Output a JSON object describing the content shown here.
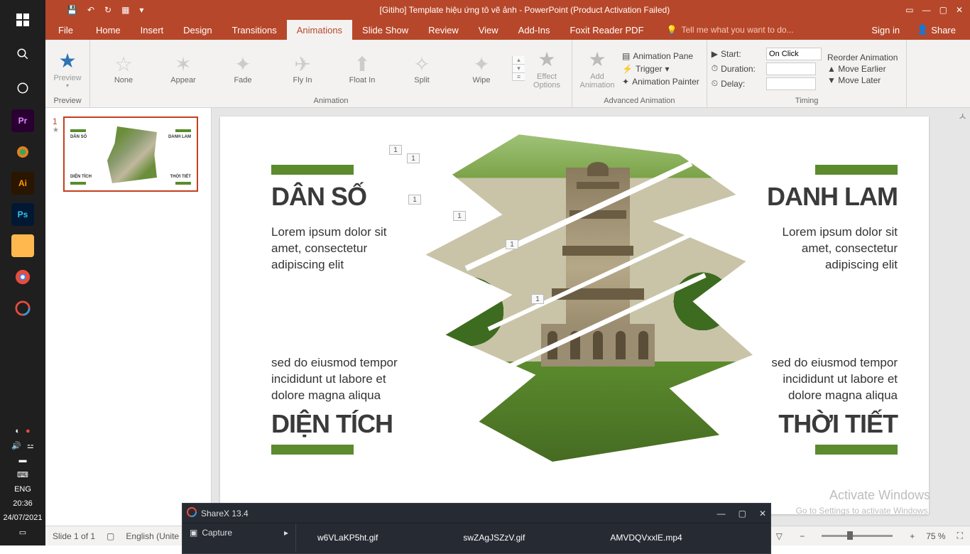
{
  "titlebar": {
    "title": "[Gitiho] Template hiệu ứng tô vẽ ảnh - PowerPoint (Product Activation Failed)"
  },
  "tabs": {
    "file": "File",
    "home": "Home",
    "insert": "Insert",
    "design": "Design",
    "transitions": "Transitions",
    "animations": "Animations",
    "slideshow": "Slide Show",
    "review": "Review",
    "view": "View",
    "addins": "Add-Ins",
    "foxit": "Foxit Reader PDF",
    "tellme": "Tell me what you want to do...",
    "signin": "Sign in",
    "share": "Share"
  },
  "ribbon": {
    "preview": "Preview",
    "preview_label": "Preview",
    "none": "None",
    "appear": "Appear",
    "fade": "Fade",
    "flyin": "Fly In",
    "floatin": "Float In",
    "split": "Split",
    "wipe": "Wipe",
    "effect_options": "Effect\nOptions",
    "animation_label": "Animation",
    "add_animation": "Add\nAnimation",
    "animation_pane": "Animation Pane",
    "trigger": "Trigger",
    "animation_painter": "Animation Painter",
    "adv_label": "Advanced Animation",
    "start": "Start:",
    "start_val": "On Click",
    "duration": "Duration:",
    "delay": "Delay:",
    "timing_label": "Timing",
    "reorder": "Reorder Animation",
    "move_earlier": "Move Earlier",
    "move_later": "Move Later"
  },
  "slide_panel": {
    "num": "1"
  },
  "slide": {
    "h1": "DÂN SỐ",
    "p1": "Lorem ipsum dolor sit amet, consectetur adipiscing elit",
    "p2": "sed do eiusmod tempor incididunt ut labore et dolore magna aliqua",
    "h2": "DIỆN TÍCH",
    "h3": "DANH LAM",
    "p3": "Lorem ipsum dolor sit amet, consectetur adipiscing elit",
    "p4": "sed do eiusmod tempor incididunt ut labore et dolore magna aliqua",
    "h4": "THỜI TIẾT",
    "tag": "1"
  },
  "watermark": {
    "title": "Activate Windows",
    "sub": "Go to Settings to activate Windows."
  },
  "statusbar": {
    "slide": "Slide 1 of 1",
    "lang": "English (Unite",
    "zoom": "75 %"
  },
  "sharex": {
    "title": "ShareX 13.4",
    "capture": "Capture",
    "f1": "w6VLaKP5ht.gif",
    "f2": "swZAgJSZzV.gif",
    "f3": "AMVDQVxxlE.mp4"
  },
  "taskbar": {
    "lang": "ENG",
    "time": "20:36",
    "date": "24/07/2021"
  }
}
